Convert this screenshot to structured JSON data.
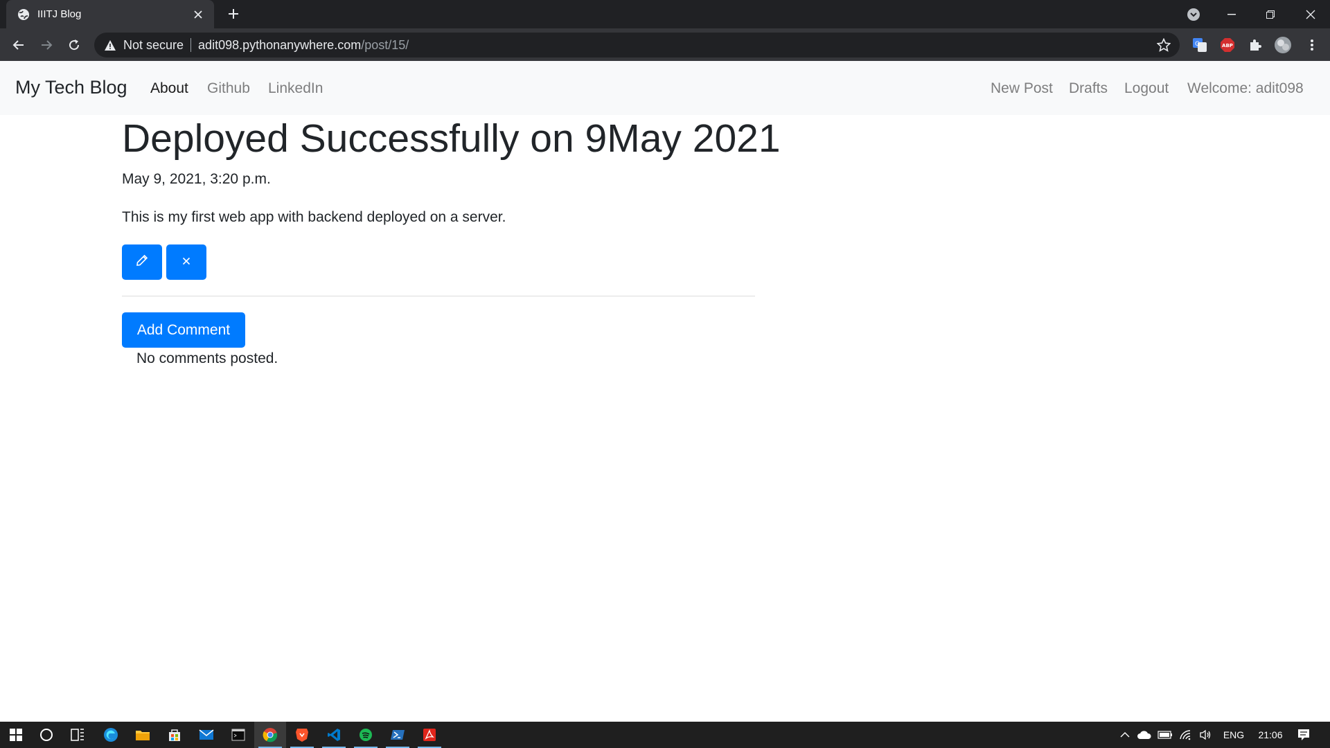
{
  "browser": {
    "tab_title": "IIITJ Blog",
    "not_secure_label": "Not secure",
    "url_host": "adit098.pythonanywhere.com",
    "url_path": "/post/15/",
    "abp_label": "ABP"
  },
  "site": {
    "brand": "My Tech Blog",
    "nav_left": [
      "About",
      "Github",
      "LinkedIn"
    ],
    "nav_right": [
      "New Post",
      "Drafts",
      "Logout",
      "Welcome: adit098"
    ]
  },
  "post": {
    "title": "Deployed Successfully on 9May 2021",
    "date": "May 9, 2021, 3:20 p.m.",
    "body": "This is my first web app with backend deployed on a server.",
    "add_comment_label": "Add Comment",
    "no_comments_text": "No comments posted."
  },
  "taskbar": {
    "language": "ENG",
    "time": "21:06"
  },
  "colors": {
    "primary": "#007bff",
    "navbar_bg": "#f8f9fa",
    "chrome_dark": "#202124",
    "chrome_toolbar": "#35363a",
    "taskbar_bg": "#1f1f1f"
  }
}
